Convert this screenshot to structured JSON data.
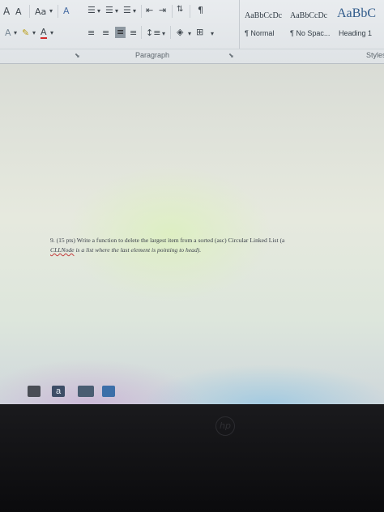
{
  "ribbon": {
    "font_group": {
      "grow_font": "A",
      "shrink_font": "A",
      "change_case": "Aa",
      "text_effects": "A",
      "highlight": "",
      "font_color": "A"
    },
    "paragraph_group": {
      "label": "Paragraph"
    },
    "styles_group": {
      "label": "Styles",
      "styles": [
        {
          "preview": "AaBbCcDc",
          "name": "¶ Normal"
        },
        {
          "preview": "AaBbCcDc",
          "name": "¶ No Spac..."
        },
        {
          "preview": "AaBbC",
          "name": "Heading 1"
        }
      ]
    }
  },
  "document": {
    "question_line1": "9. (15 pts) Write a function to delete the largest item from a sorted (asc) Circular Linked List (a",
    "question_line2_term": "CLLNode",
    "question_line2_rest": " is a list where the last element is pointing to head)."
  },
  "taskbar": {
    "icons": [
      "store-icon",
      "amazon-icon",
      "network-icon",
      "word-icon"
    ]
  }
}
